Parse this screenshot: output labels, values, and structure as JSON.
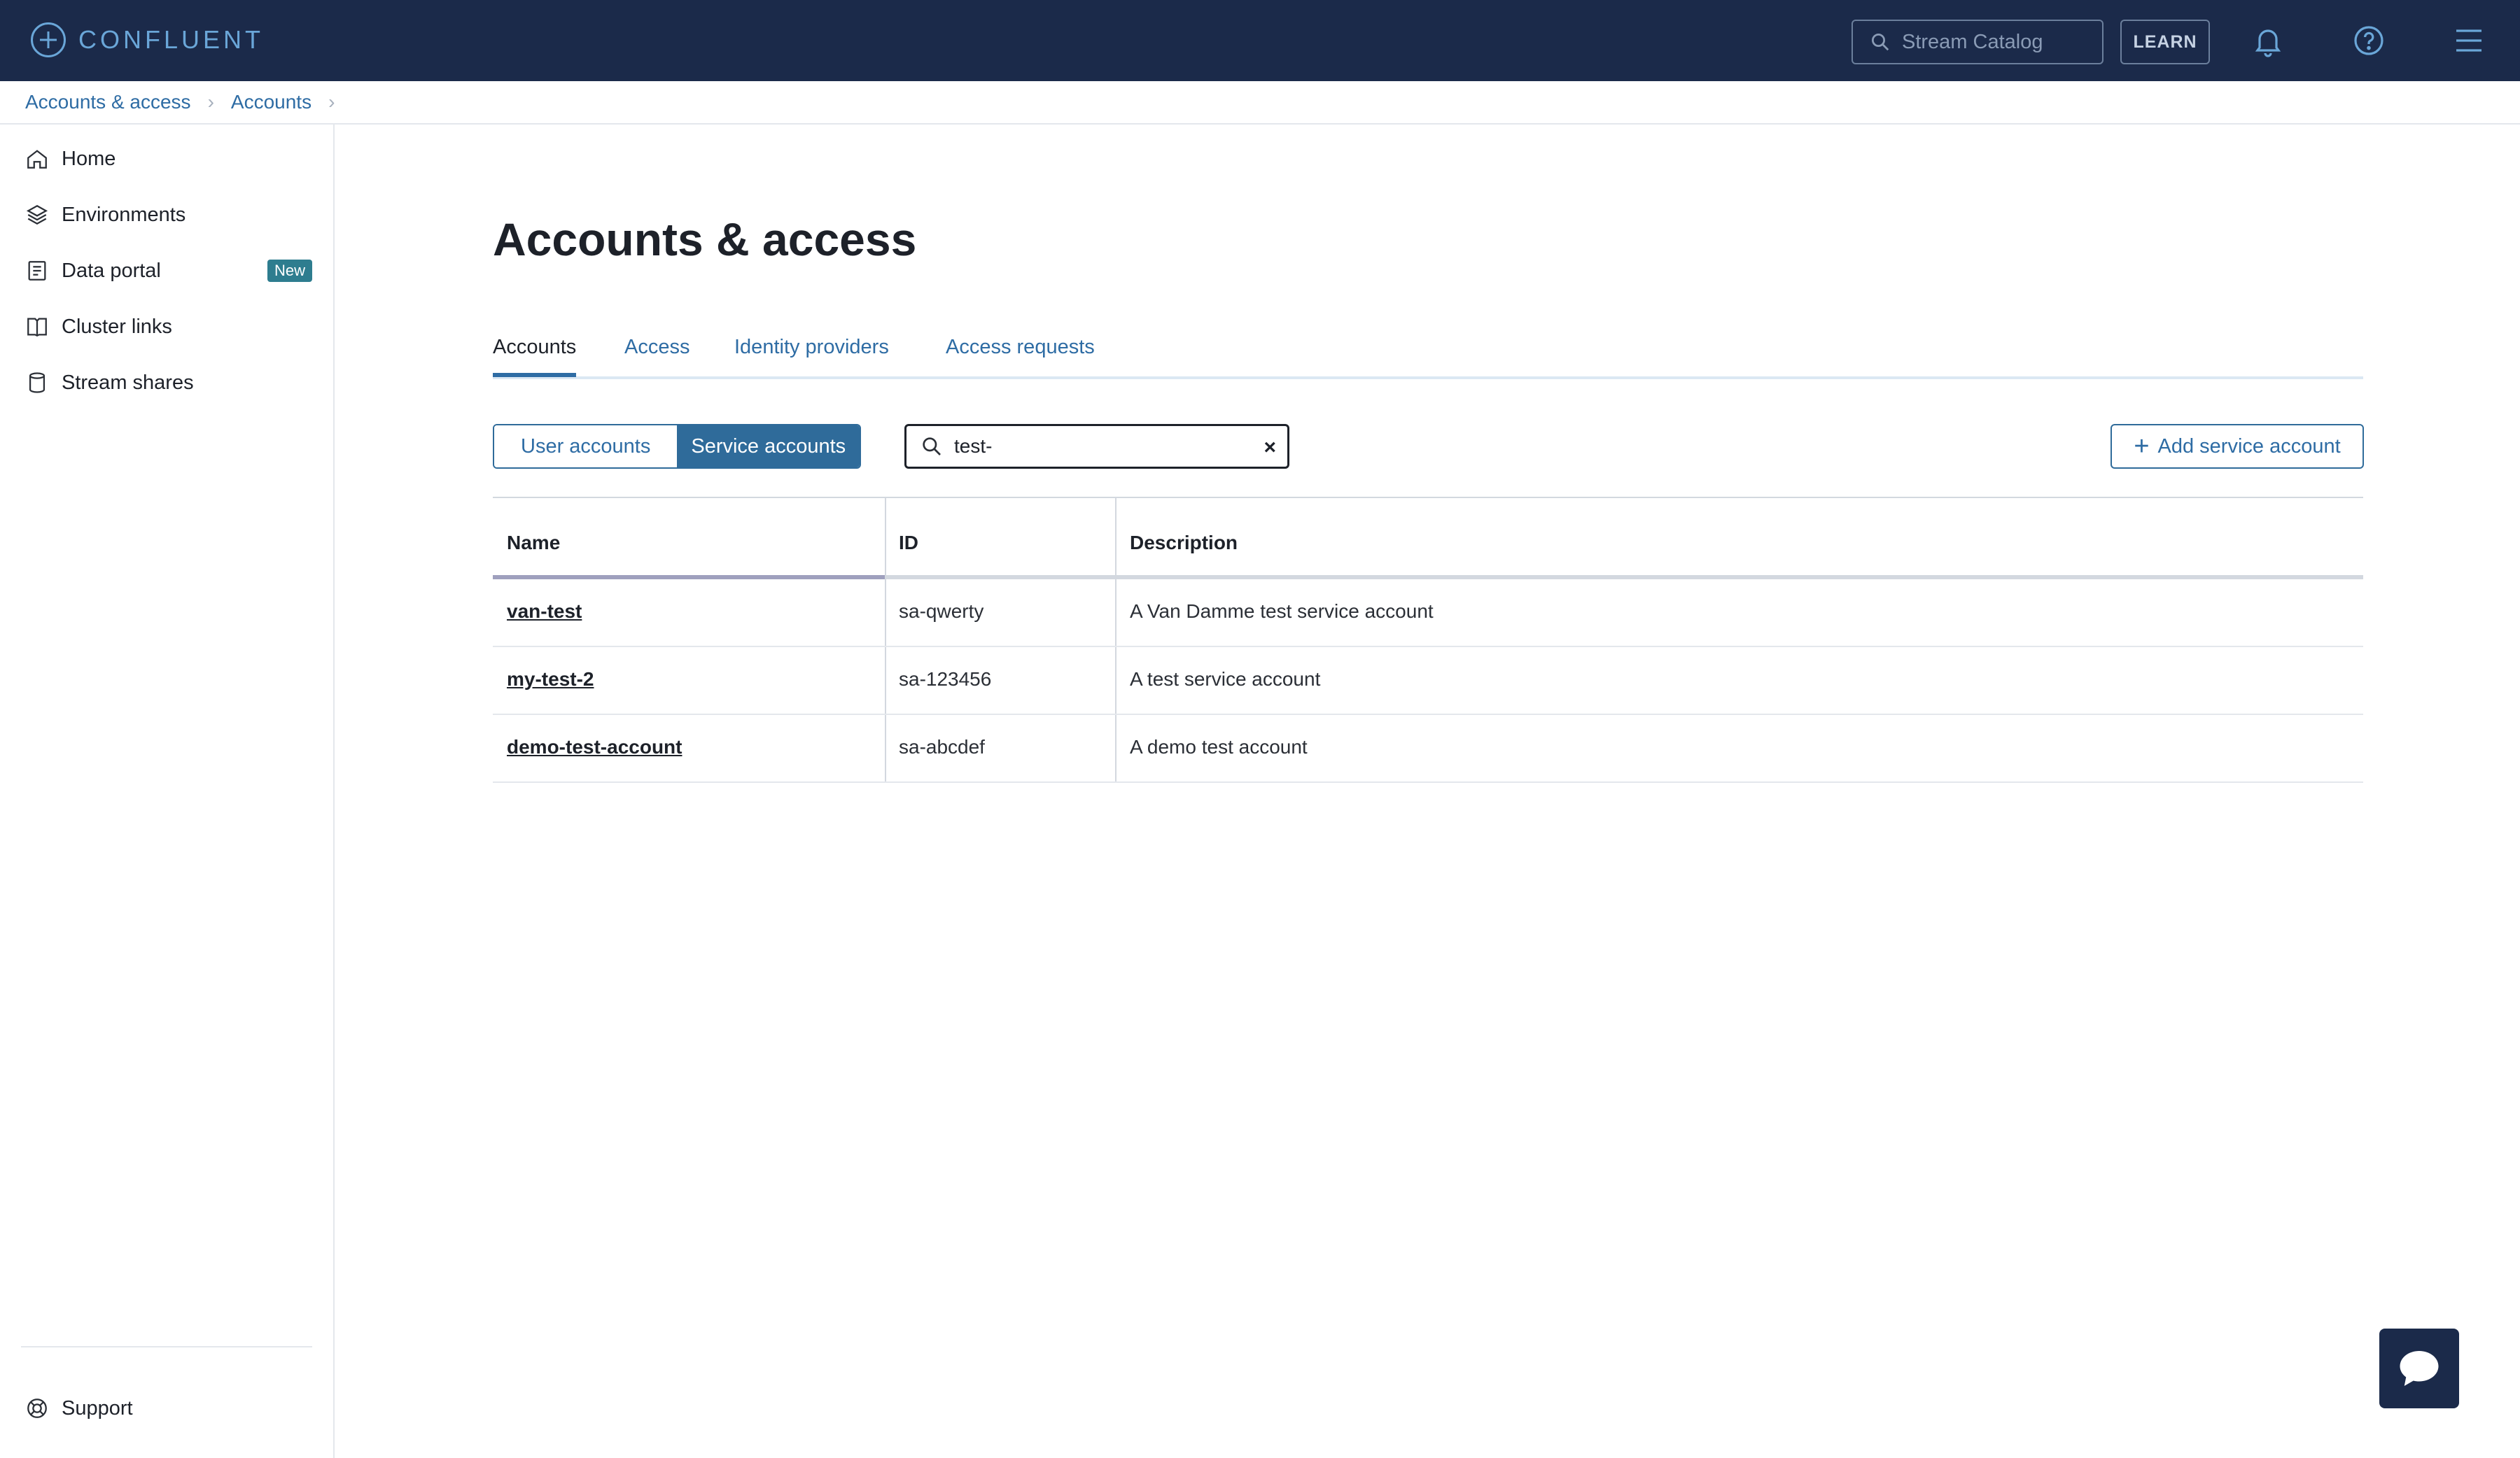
{
  "topbar": {
    "brand": "CONFLUENT",
    "search_placeholder": "Stream Catalog",
    "learn_label": "LEARN"
  },
  "breadcrumb": {
    "items": [
      "Accounts & access",
      "Accounts"
    ]
  },
  "sidebar": {
    "items": [
      {
        "label": "Home",
        "icon": "home-icon"
      },
      {
        "label": "Environments",
        "icon": "layers-icon"
      },
      {
        "label": "Data portal",
        "icon": "document-icon",
        "badge": "New"
      },
      {
        "label": "Cluster links",
        "icon": "book-link-icon"
      },
      {
        "label": "Stream shares",
        "icon": "database-icon"
      }
    ],
    "support_label": "Support"
  },
  "main": {
    "title": "Accounts & access",
    "tabs": [
      {
        "label": "Accounts",
        "active": true
      },
      {
        "label": "Access",
        "active": false
      },
      {
        "label": "Identity providers",
        "active": false
      },
      {
        "label": "Access requests",
        "active": false
      }
    ],
    "segment": {
      "user_label": "User accounts",
      "service_label": "Service accounts",
      "selected": "Service accounts"
    },
    "filter": {
      "value": "test-",
      "clear_label": "×"
    },
    "add_button_label": "Add service account",
    "table": {
      "columns": [
        "Name",
        "ID",
        "Description"
      ],
      "rows": [
        {
          "name": "van-test",
          "id": "sa-qwerty",
          "description": "A Van Damme test service account"
        },
        {
          "name": "my-test-2",
          "id": "sa-123456",
          "description": "A test service account"
        },
        {
          "name": "demo-test-account",
          "id": "sa-abcdef",
          "description": "A demo test account"
        }
      ]
    }
  },
  "colors": {
    "topbar_bg": "#1b2a4a",
    "accent": "#2f6b9a",
    "link": "#2e6ca4",
    "badge": "#2e7d8f"
  }
}
